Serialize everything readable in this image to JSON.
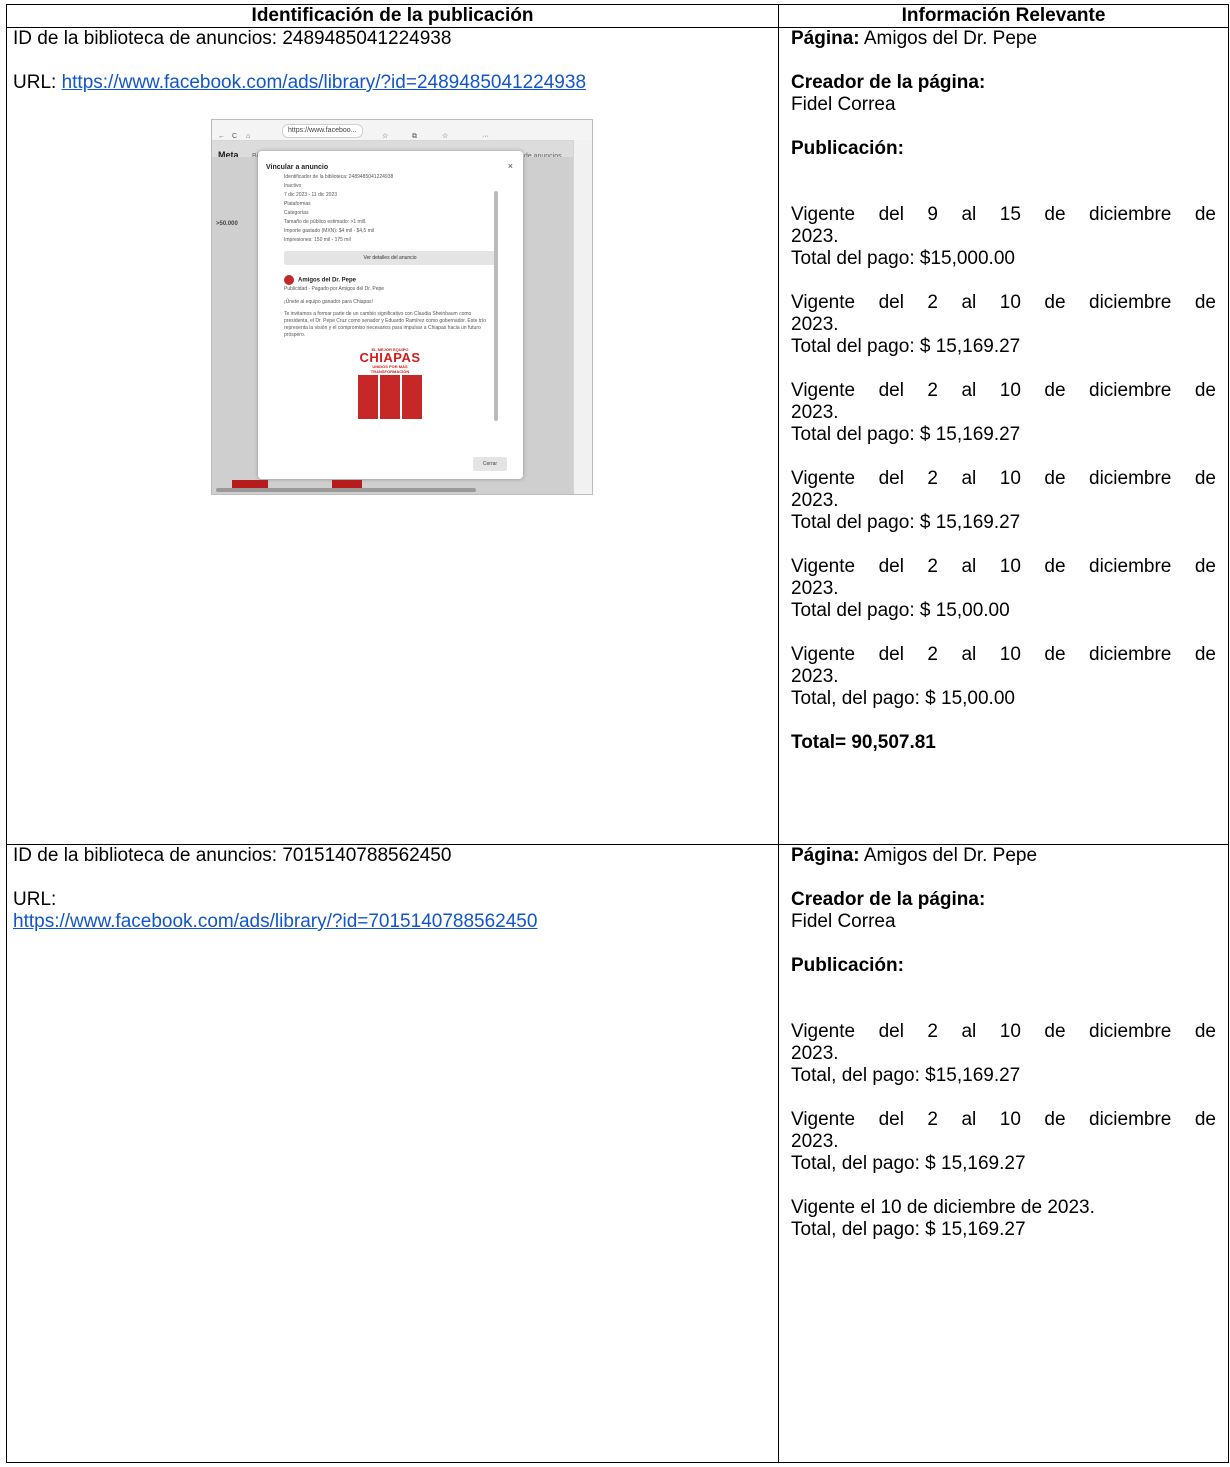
{
  "headers": {
    "left": "Identificación de la publicación",
    "right": "Información Relevante"
  },
  "rows": [
    {
      "id_line": "ID de la biblioteca de anuncios: 2489485041224938",
      "url_label": "URL:",
      "url": "https://www.facebook.com/ads/library/?id=2489485041224938",
      "pagina_label": "Página:",
      "pagina": "Amigos del Dr. Pepe",
      "creador_label": "Creador de la página:",
      "creador": "Fidel Correa",
      "publicacion_label": "Publicación:",
      "entries": [
        {
          "vigente_a": "Vigente del 9 al 15 de diciembre de",
          "vigente_b": "2023.",
          "total": "Total del pago: $15,000.00"
        },
        {
          "vigente_a": "Vigente del 2 al 10 de diciembre de",
          "vigente_b": "2023.",
          "total": "Total del pago: $ 15,169.27"
        },
        {
          "vigente_a": "Vigente del 2 al 10 de diciembre de",
          "vigente_b": "2023.",
          "total": "Total del pago: $ 15,169.27"
        },
        {
          "vigente_a": "Vigente del 2 al 10 de diciembre de",
          "vigente_b": "2023.",
          "total": "Total del pago: $ 15,169.27"
        },
        {
          "vigente_a": "Vigente del 2 al 10 de diciembre de",
          "vigente_b": "2023.",
          "total": "Total del pago: $ 15,00.00"
        },
        {
          "vigente_a": "Vigente del 2 al 10 de diciembre de",
          "vigente_b": "2023.",
          "total": "Total, del pago: $ 15,00.00"
        }
      ],
      "grand_total": "Total= 90,507.81"
    },
    {
      "id_line": "ID de la biblioteca de anuncios: 7015140788562450",
      "url_label": "URL:",
      "url": "https://www.facebook.com/ads/library/?id=7015140788562450",
      "pagina_label": "Página:",
      "pagina": "Amigos del Dr. Pepe",
      "creador_label": "Creador de la página:",
      "creador": "Fidel Correa",
      "publicacion_label": "Publicación:",
      "entries": [
        {
          "vigente_a": "Vigente del 2 al 10 de diciembre de",
          "vigente_b": "2023.",
          "total": "Total, del pago: $15,169.27"
        },
        {
          "vigente_a": "Vigente del 2 al 10 de diciembre de",
          "vigente_b": "2023.",
          "total": "Total, del pago: $ 15,169.27"
        }
      ],
      "last_entry": {
        "line1": "Vigente el 10 de diciembre de 2023.",
        "line2": "Total, del pago: $ 15,169.27"
      }
    }
  ],
  "screenshot": {
    "url_bar": "https://www.faceboo...",
    "meta_logo": "Meta",
    "meta_nav": [
      "Biblioteca de anuncios",
      "Informe de la biblioteca de anuncios",
      "API de la biblioteca de anuncios"
    ],
    "modal_title": "Vincular a anuncio",
    "lib_id": "Identificador de la biblioteca: 2489485041224938",
    "status": "Inactivo",
    "dates": "7 dic 2023 - 11 dic 2023",
    "platforms": "Plataformas",
    "categories": "Categorías",
    "audience": "Tamaño de público estimado: >1 mill.",
    "spent": "Importe gastado (MXN): $4 mil - $4,5 mil",
    "impressions": "Impresiones: 150 mil - 175 mil",
    "details_button": "Ver detalles del anuncio",
    "ad_page": "Amigos del Dr. Pepe",
    "ad_sub": "Publicidad · Pagado por Amigos del Dr. Pepe",
    "ad_q": "¡Únete al equipo ganador para Chiapas!",
    "ad_body": "Te invitamos a formar parte de un cambio significativo con Claudia Sheinbaum como presidenta, el Dr. Pepe Cruz como senador y Eduardo Ramírez como gobernador. Este trío representa la visión y el compromiso necesarios para impulsar a Chiapas hacia un futuro próspero.",
    "poster_top": "EL MEJOR EQUIPO",
    "poster_title": "CHIAPAS",
    "poster_sub": "UNIDOS POR MÁS TRANSFORMACIÓN",
    "close_button": "Cerrar",
    "bg_count": ">50.000"
  }
}
